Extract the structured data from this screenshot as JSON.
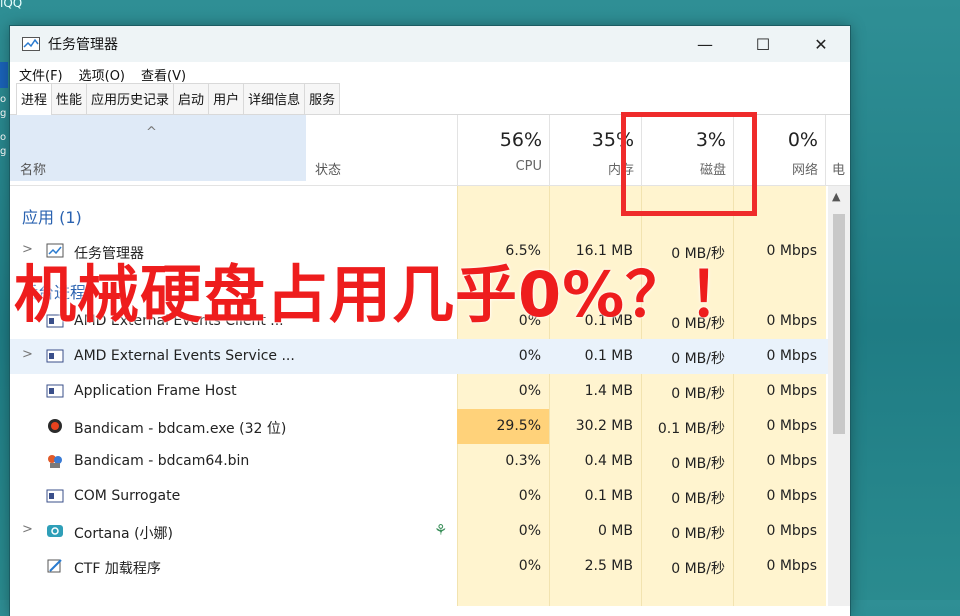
{
  "desktop": {
    "corner_label": "iQQ",
    "side_chars": [
      "o",
      "g",
      "o",
      "g"
    ]
  },
  "window": {
    "title": "任务管理器",
    "controls": {
      "minimize": "—",
      "maximize": "☐",
      "close": "✕"
    }
  },
  "menu": [
    "文件(F)",
    "选项(O)",
    "查看(V)"
  ],
  "tabs": [
    "进程",
    "性能",
    "应用历史记录",
    "启动",
    "用户",
    "详细信息",
    "服务"
  ],
  "header": {
    "sort_arrow": "^",
    "name": "名称",
    "status": "状态",
    "columns": [
      {
        "pct": "56%",
        "label": "CPU"
      },
      {
        "pct": "35%",
        "label": "内存"
      },
      {
        "pct": "3%",
        "label": "磁盘"
      },
      {
        "pct": "0%",
        "label": "网络"
      }
    ],
    "extra_col_fragment": "电"
  },
  "group_label": "应用 (1)",
  "rows": [
    {
      "name": "任务管理器",
      "cpu": "6.5%",
      "mem": "16.1 MB",
      "disk": "0 MB/秒",
      "net": "0 Mbps",
      "expand": ">"
    },
    {
      "name": "后台进程",
      "cpu": "",
      "mem": "",
      "disk": "",
      "net": "",
      "expand": ""
    },
    {
      "name": "AMD External Events Client ...",
      "cpu": "0%",
      "mem": "0.1 MB",
      "disk": "0 MB/秒",
      "net": "0 Mbps",
      "expand": ""
    },
    {
      "name": "AMD External Events Service ...",
      "cpu": "0%",
      "mem": "0.1 MB",
      "disk": "0 MB/秒",
      "net": "0 Mbps",
      "expand": ">"
    },
    {
      "name": "Application Frame Host",
      "cpu": "0%",
      "mem": "1.4 MB",
      "disk": "0 MB/秒",
      "net": "0 Mbps",
      "expand": ""
    },
    {
      "name": "Bandicam - bdcam.exe (32 位)",
      "cpu": "29.5%",
      "mem": "30.2 MB",
      "disk": "0.1 MB/秒",
      "net": "0 Mbps",
      "expand": ""
    },
    {
      "name": "Bandicam - bdcam64.bin",
      "cpu": "0.3%",
      "mem": "0.4 MB",
      "disk": "0 MB/秒",
      "net": "0 Mbps",
      "expand": ""
    },
    {
      "name": "COM Surrogate",
      "cpu": "0%",
      "mem": "0.1 MB",
      "disk": "0 MB/秒",
      "net": "0 Mbps",
      "expand": ""
    },
    {
      "name": "Cortana (小娜)",
      "cpu": "0%",
      "mem": "0 MB",
      "disk": "0 MB/秒",
      "net": "0 Mbps",
      "expand": ">"
    },
    {
      "name": "CTF 加载程序",
      "cpu": "0%",
      "mem": "2.5 MB",
      "disk": "0 MB/秒",
      "net": "0 Mbps",
      "expand": ""
    }
  ],
  "overlay_text": "机械硬盘占用几乎0%？！",
  "colors": {
    "heat": "#fff4cf",
    "hot": "#ffd27a",
    "accent": "#ef2b2b",
    "group": "#2a62b0"
  }
}
